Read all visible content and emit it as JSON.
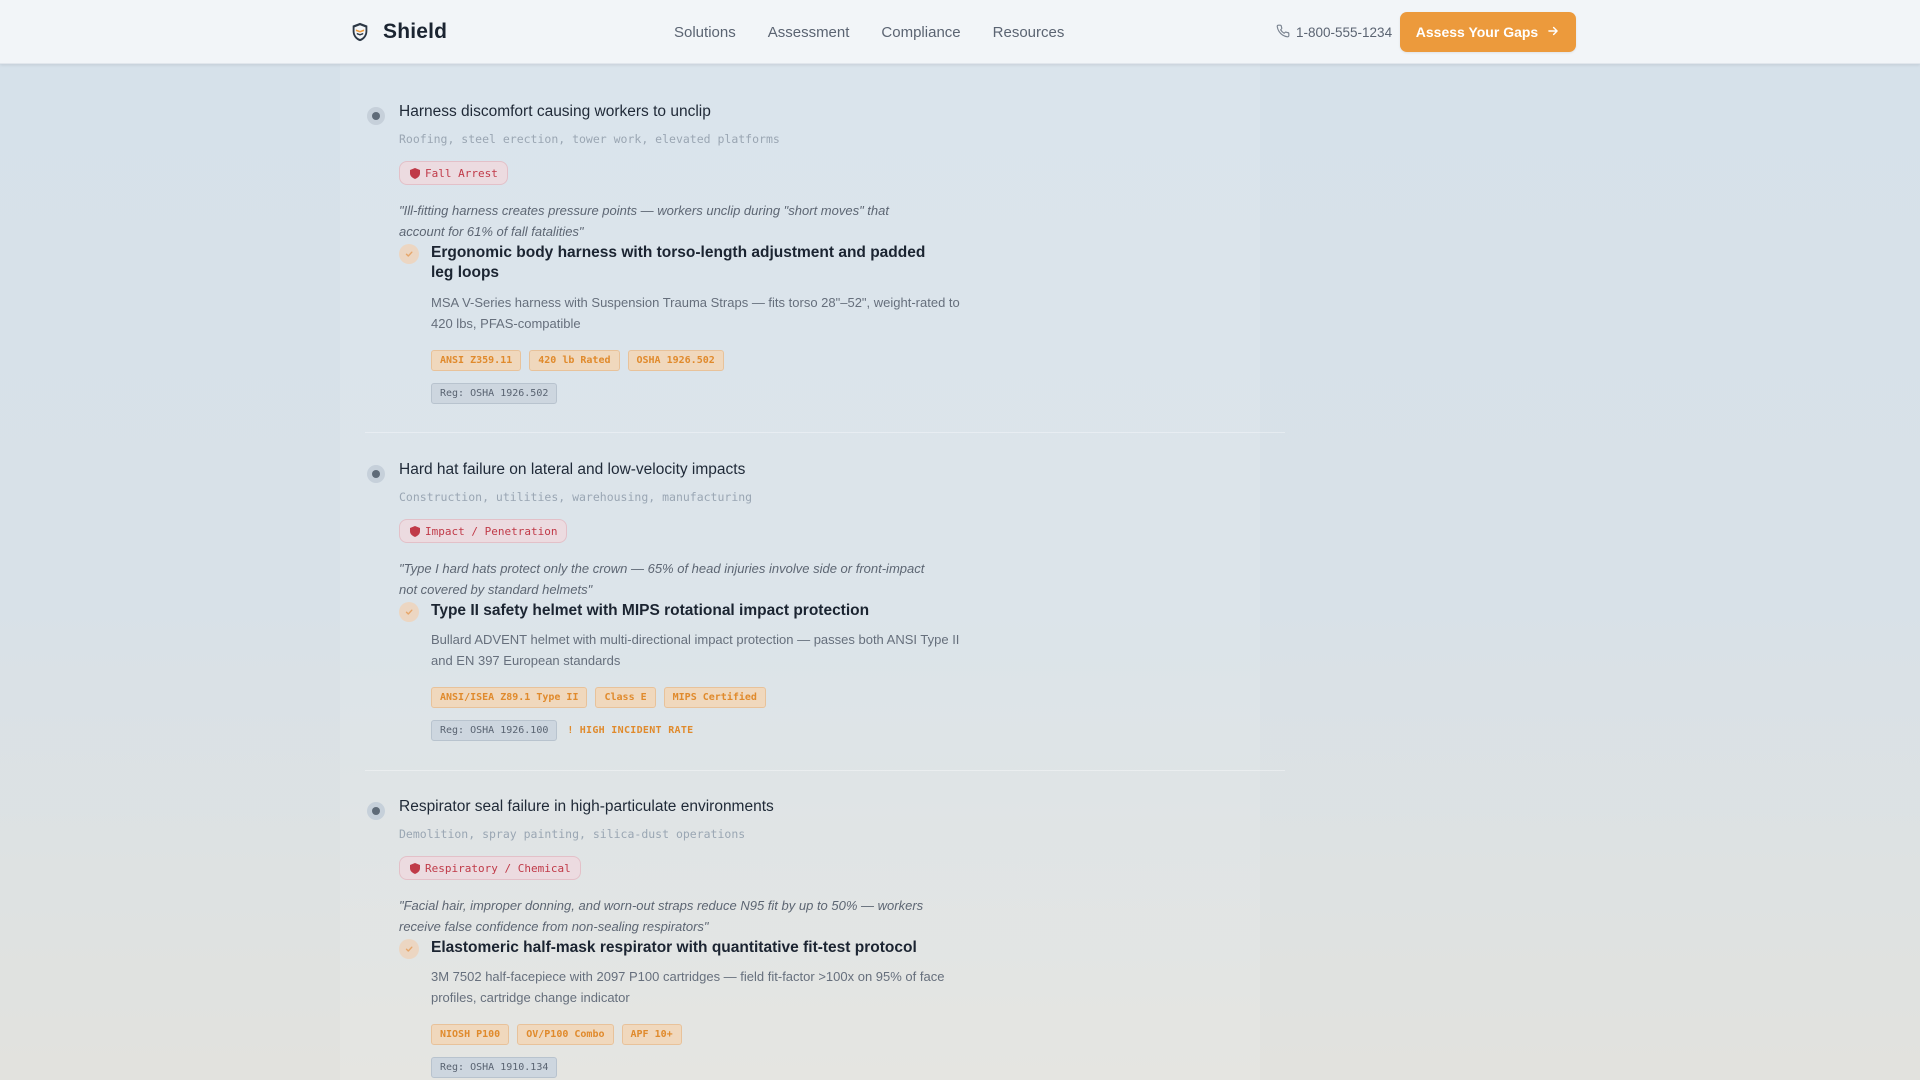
{
  "header": {
    "brand": "Shield",
    "nav": [
      "Solutions",
      "Assessment",
      "Compliance",
      "Resources"
    ],
    "phone": "1-800-555-1234",
    "cta_label": "Assess Your Gaps"
  },
  "items": [
    {
      "title": "Harness discomfort causing workers to unclip",
      "industries": "Roofing, steel erection, tower work, elevated platforms",
      "hazard": "Fall Arrest",
      "quote": "\"Ill-fitting harness creates pressure points — workers unclip during \"short moves\" that account for 61% of fall fatalities\"",
      "solution_title": "Ergonomic body harness with torso-length adjustment and padded leg loops",
      "solution_desc": "MSA V-Series harness with Suspension Trauma Straps — fits torso 28\"–52\", weight-rated to 420 lbs, PFAS-compatible",
      "tags": [
        "ANSI Z359.11",
        "420 lb Rated",
        "OSHA 1926.502"
      ],
      "regulation": "Reg: OSHA 1926.502",
      "alert": ""
    },
    {
      "title": "Hard hat failure on lateral and low-velocity impacts",
      "industries": "Construction, utilities, warehousing, manufacturing",
      "hazard": "Impact / Penetration",
      "quote": "\"Type I hard hats protect only the crown — 65% of head injuries involve side or front-impact not covered by standard helmets\"",
      "solution_title": "Type II safety helmet with MIPS rotational impact protection",
      "solution_desc": "Bullard ADVENT helmet with multi-directional impact protection — passes both ANSI Type II and EN 397 European standards",
      "tags": [
        "ANSI/ISEA Z89.1 Type II",
        "Class E",
        "MIPS Certified"
      ],
      "regulation": "Reg: OSHA 1926.100",
      "alert": "HIGH INCIDENT RATE"
    },
    {
      "title": "Respirator seal failure in high-particulate environments",
      "industries": "Demolition, spray painting, silica-dust operations",
      "hazard": "Respiratory / Chemical",
      "quote": "\"Facial hair, improper donning, and worn-out straps reduce N95 fit by up to 50% — workers receive false confidence from non-sealing respirators\"",
      "solution_title": "Elastomeric half-mask respirator with quantitative fit-test protocol",
      "solution_desc": "3M 7502 half-facepiece with 2097 P100 cartridges — field fit-factor >100x on 95% of face profiles, cartridge change indicator",
      "tags": [
        "NIOSH P100",
        "OV/P100 Combo",
        "APF 10+"
      ],
      "regulation": "Reg: OSHA 1910.134",
      "alert": ""
    }
  ],
  "colors": {
    "accent": "#ec9a3c",
    "hazard_text": "#c03a48",
    "tag_text": "#e08a2c"
  }
}
